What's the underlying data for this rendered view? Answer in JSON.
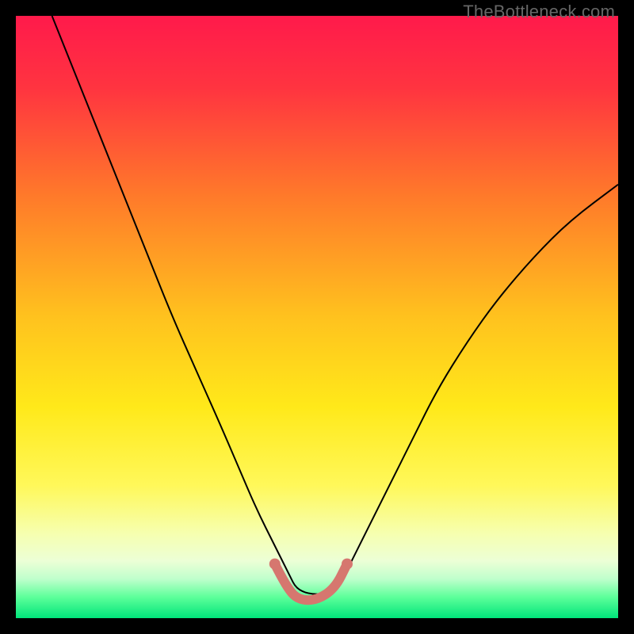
{
  "watermark": "TheBottleneck.com",
  "chart_data": {
    "type": "line",
    "title": "",
    "xlabel": "",
    "ylabel": "",
    "xlim": [
      0,
      100
    ],
    "ylim": [
      0,
      100
    ],
    "grid": false,
    "legend": false,
    "background_gradient": {
      "stops": [
        {
          "offset": 0.0,
          "color": "#ff1a4b"
        },
        {
          "offset": 0.12,
          "color": "#ff3440"
        },
        {
          "offset": 0.3,
          "color": "#ff7a2a"
        },
        {
          "offset": 0.5,
          "color": "#ffc21e"
        },
        {
          "offset": 0.65,
          "color": "#ffe91a"
        },
        {
          "offset": 0.78,
          "color": "#fff85a"
        },
        {
          "offset": 0.86,
          "color": "#f6ffb0"
        },
        {
          "offset": 0.905,
          "color": "#ecffd6"
        },
        {
          "offset": 0.935,
          "color": "#bfffcc"
        },
        {
          "offset": 0.965,
          "color": "#5dff9a"
        },
        {
          "offset": 1.0,
          "color": "#00e57a"
        }
      ]
    },
    "series": [
      {
        "name": "bottleneck-curve",
        "color": "#000000",
        "width": 2,
        "x": [
          6,
          10,
          14,
          18,
          22,
          26,
          30,
          34,
          37,
          40,
          43,
          45,
          47,
          53,
          55,
          58,
          62,
          66,
          70,
          75,
          80,
          86,
          92,
          100
        ],
        "y": [
          100,
          90,
          80,
          70,
          60,
          50,
          41,
          32,
          25,
          18,
          12,
          8,
          4,
          4,
          8,
          14,
          22,
          30,
          38,
          46,
          53,
          60,
          66,
          72
        ]
      },
      {
        "name": "valley-highlight",
        "color": "#d6776f",
        "width": 12,
        "linecap": "round",
        "dots": true,
        "dot_radius": 7,
        "x": [
          43,
          45,
          47,
          50,
          53,
          55
        ],
        "y": [
          9,
          5,
          3,
          3,
          5,
          9
        ]
      }
    ]
  }
}
